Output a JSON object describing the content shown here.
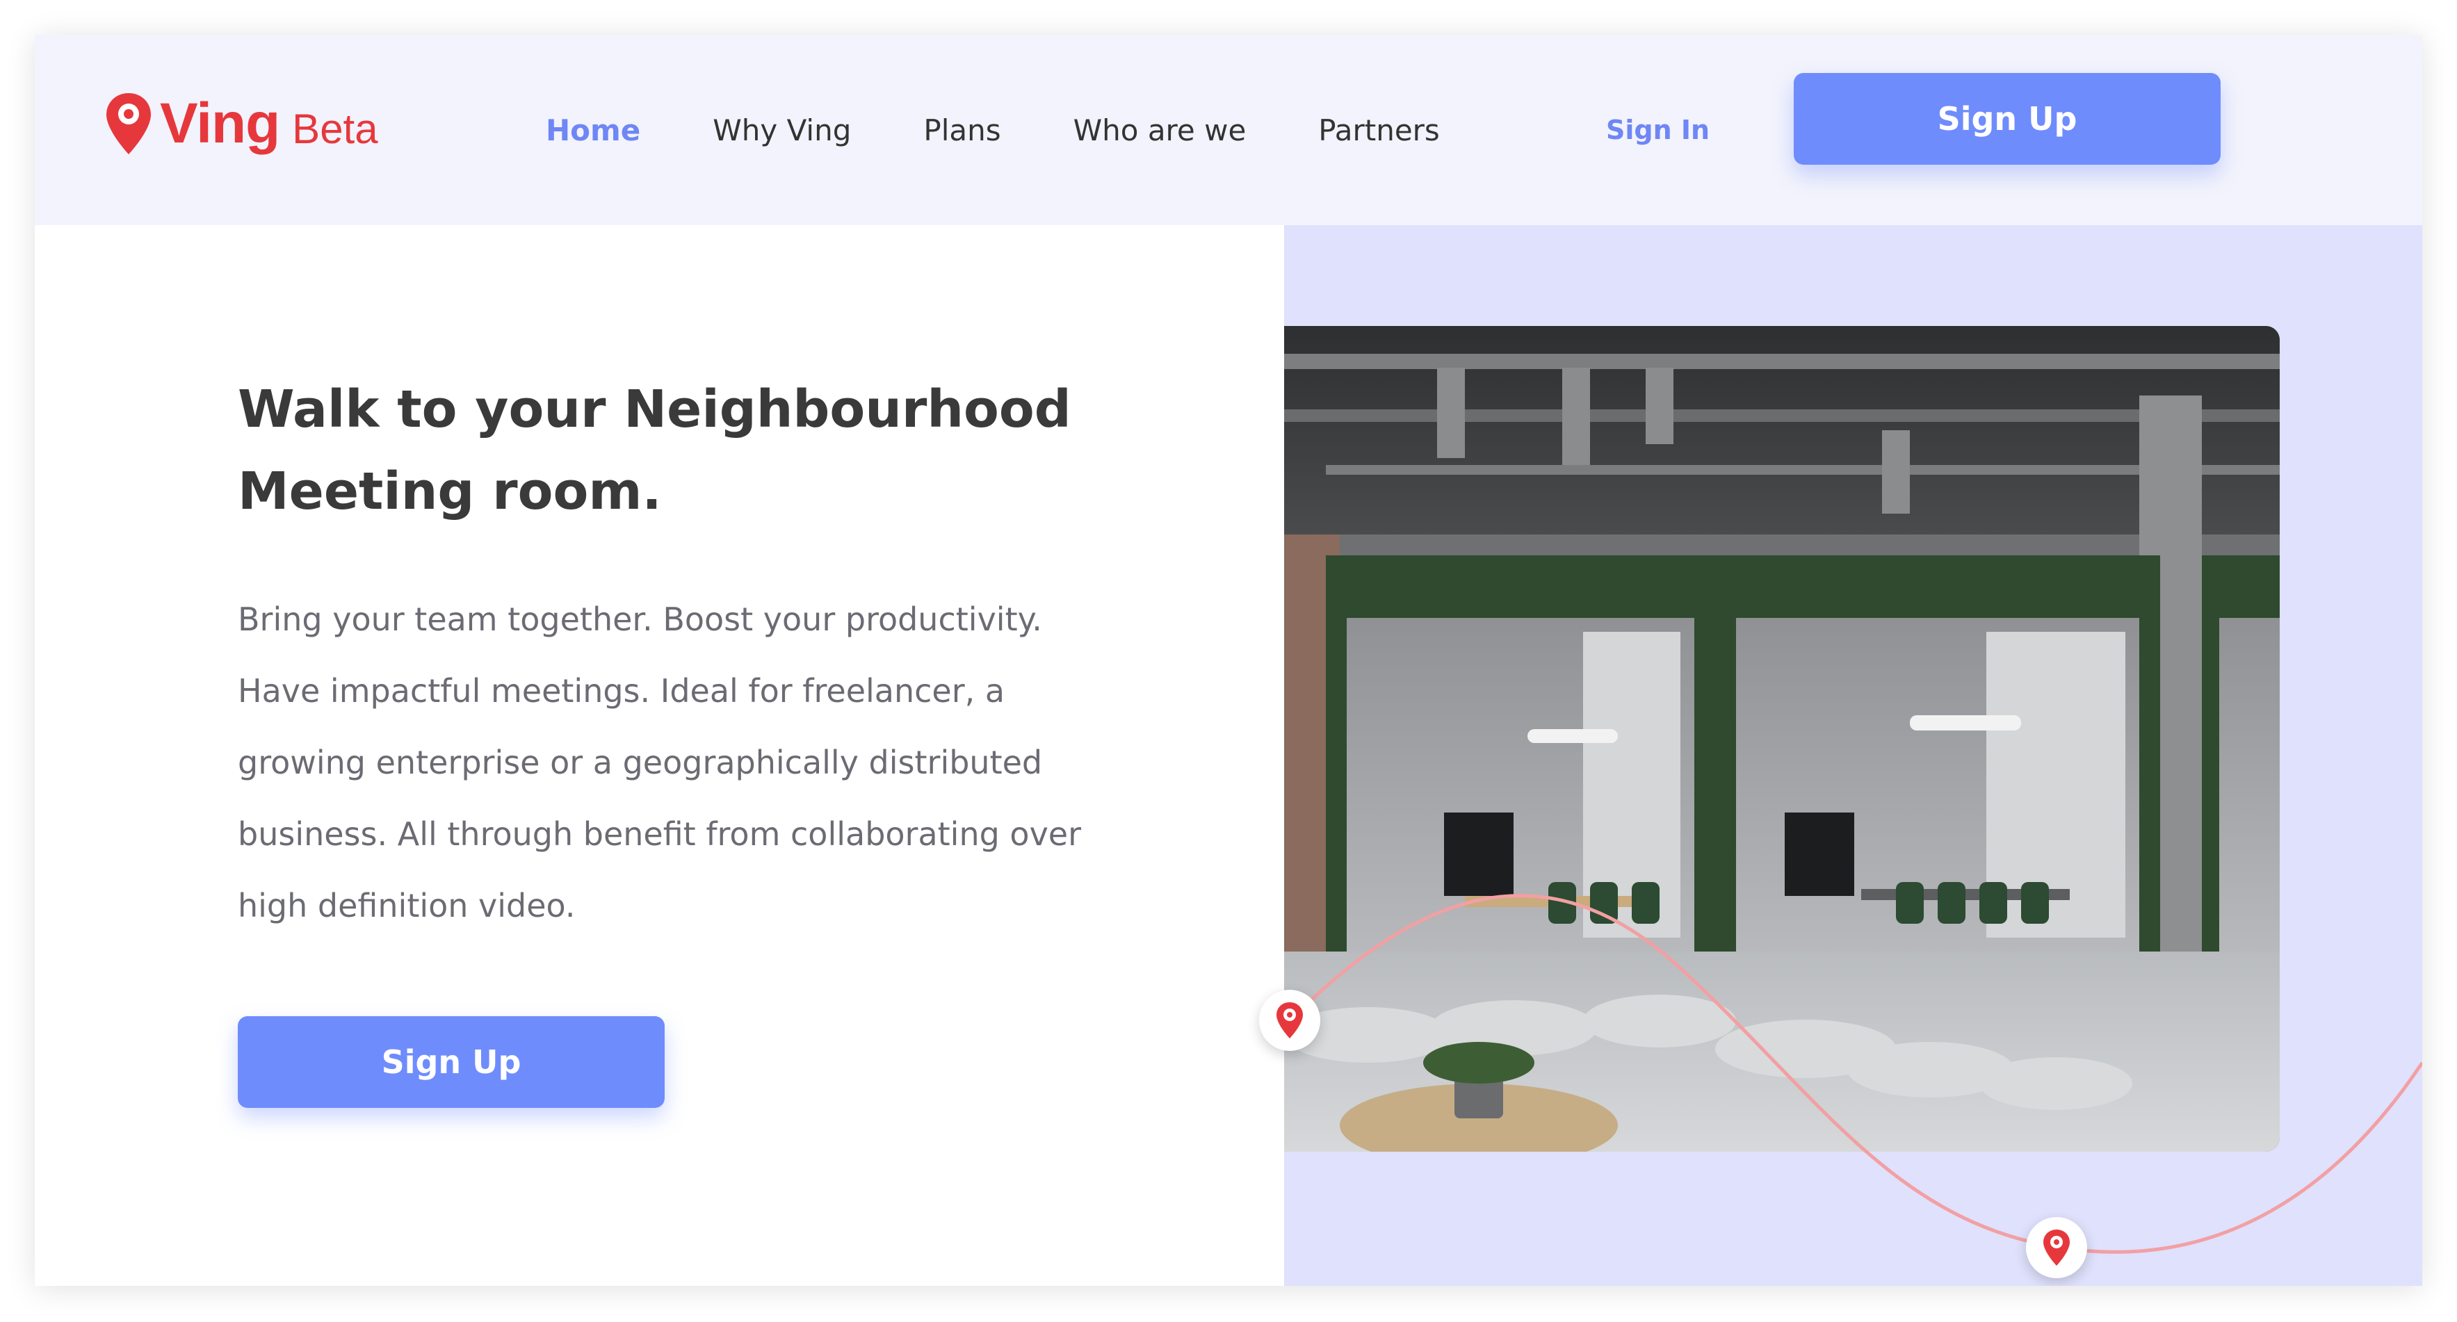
{
  "brand": {
    "name": "Ving",
    "tag": "Beta",
    "color": "#e6383c"
  },
  "nav": {
    "items": [
      {
        "label": "Home",
        "active": true
      },
      {
        "label": "Why Ving",
        "active": false
      },
      {
        "label": "Plans",
        "active": false
      },
      {
        "label": "Who are we",
        "active": false
      },
      {
        "label": "Partners",
        "active": false
      }
    ],
    "signin_label": "Sign In",
    "signup_label": "Sign Up"
  },
  "hero": {
    "title_line1": "Walk to your Neighbourhood",
    "title_line2": "Meeting room.",
    "body_lines": [
      "Bring your team together. Boost your productivity.",
      "Have impactful meetings. Ideal for freelancer, a",
      "growing enterprise or a geographically distributed",
      "business. All through benefit from collaborating over",
      "high definition video."
    ],
    "cta_label": "Sign Up",
    "image_name": "meeting-room-photo"
  },
  "colors": {
    "accent": "#6f8cfd",
    "header_bg": "#f2f3fc",
    "hero_panel_bg": "#dfe1fd",
    "route_line": "#f2a0a3"
  },
  "icons": [
    "map-pin-icon"
  ]
}
